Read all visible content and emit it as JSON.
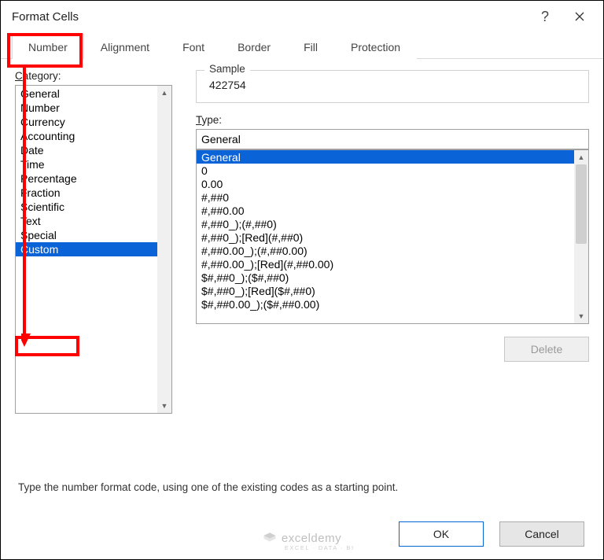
{
  "titlebar": {
    "title": "Format Cells"
  },
  "tabs": {
    "items": [
      {
        "label": "Number"
      },
      {
        "label": "Alignment"
      },
      {
        "label": "Font"
      },
      {
        "label": "Border"
      },
      {
        "label": "Fill"
      },
      {
        "label": "Protection"
      }
    ]
  },
  "category": {
    "label_pre": "C",
    "label_rest": "ategory:",
    "items": [
      "General",
      "Number",
      "Currency",
      "Accounting",
      "Date",
      "Time",
      "Percentage",
      "Fraction",
      "Scientific",
      "Text",
      "Special",
      "Custom"
    ],
    "selected_index": 11
  },
  "sample": {
    "legend": "Sample",
    "value": "422754"
  },
  "type": {
    "label_pre": "T",
    "label_rest": "ype:",
    "value": "General",
    "items": [
      "General",
      "0",
      "0.00",
      "#,##0",
      "#,##0.00",
      "#,##0_);(#,##0)",
      "#,##0_);[Red](#,##0)",
      "#,##0.00_);(#,##0.00)",
      "#,##0.00_);[Red](#,##0.00)",
      "$#,##0_);($#,##0)",
      "$#,##0_);[Red]($#,##0)",
      "$#,##0.00_);($#,##0.00)"
    ],
    "selected_index": 0
  },
  "buttons": {
    "delete": "Delete",
    "ok": "OK",
    "cancel": "Cancel"
  },
  "hint": "Type the number format code, using one of the existing codes as a starting point.",
  "watermark": {
    "brand": "exceldemy",
    "tag": "EXCEL · DATA · BI"
  }
}
